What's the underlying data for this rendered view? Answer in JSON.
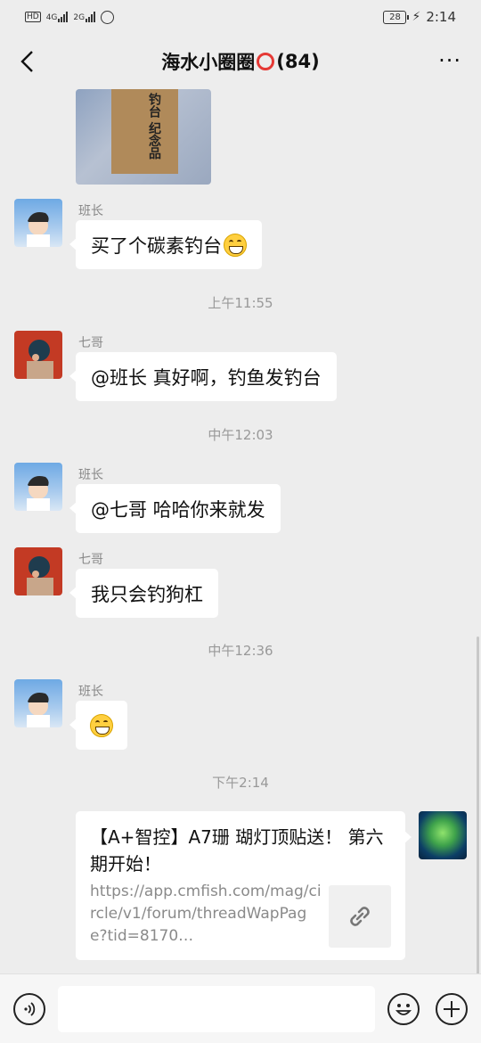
{
  "status_bar": {
    "network_1": "4G",
    "network_2": "2G",
    "battery": "28",
    "time": "2:14"
  },
  "header": {
    "title": "海水小圈圈",
    "count": "(84)",
    "more": "···"
  },
  "photo": {
    "box_text": "钓台\n纪念品"
  },
  "messages": [
    {
      "sender": "班长",
      "text": "买了个碳素钓台"
    },
    {
      "time": "上午11:55"
    },
    {
      "sender": "七哥",
      "text": "@班长  真好啊，钓鱼发钓台"
    },
    {
      "time": "中午12:03"
    },
    {
      "sender": "班长",
      "text": "@七哥  哈哈你来就发"
    },
    {
      "sender": "七哥",
      "text": "我只会钓狗杠"
    },
    {
      "time": "中午12:36"
    },
    {
      "sender": "班长"
    },
    {
      "time": "下午2:14"
    }
  ],
  "link_card": {
    "title": "【A+智控】A7珊 瑚灯顶贴送！ 第六期开始！",
    "url": "https://app.cmfish.com/mag/circle/v1/forum/threadWapPage?tid=8170…"
  },
  "icons": {
    "back": "chevron-left-icon",
    "more": "more-dots-icon",
    "link": "link-icon",
    "voice": "voice-icon",
    "emoji": "emoji-icon",
    "plus": "plus-icon"
  }
}
